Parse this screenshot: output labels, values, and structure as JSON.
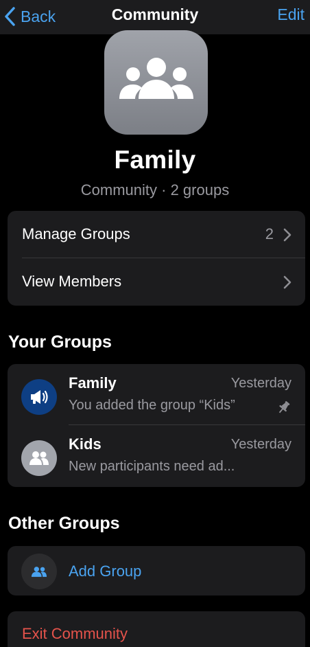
{
  "nav": {
    "back_label": "Back",
    "title": "Community",
    "edit_label": "Edit"
  },
  "community": {
    "name": "Family",
    "subtitle": "Community · 2 groups"
  },
  "settings": {
    "manage_groups_label": "Manage Groups",
    "manage_groups_count": "2",
    "view_members_label": "View Members"
  },
  "your_groups": {
    "title": "Your Groups",
    "items": [
      {
        "name": "Family",
        "time": "Yesterday",
        "message": "You added the group “Kids”",
        "icon": "megaphone-icon",
        "pinned": true
      },
      {
        "name": "Kids",
        "time": "Yesterday",
        "message": "New participants need ad...",
        "icon": "group-people-icon",
        "pinned": false
      }
    ]
  },
  "other_groups": {
    "title": "Other Groups",
    "add_group_label": "Add Group"
  },
  "exit": {
    "label": "Exit Community"
  },
  "colors": {
    "accent": "#4aa3f0",
    "destructive": "#e5534b",
    "card": "#1c1c1e",
    "secondary_text": "#9a9aa0"
  }
}
